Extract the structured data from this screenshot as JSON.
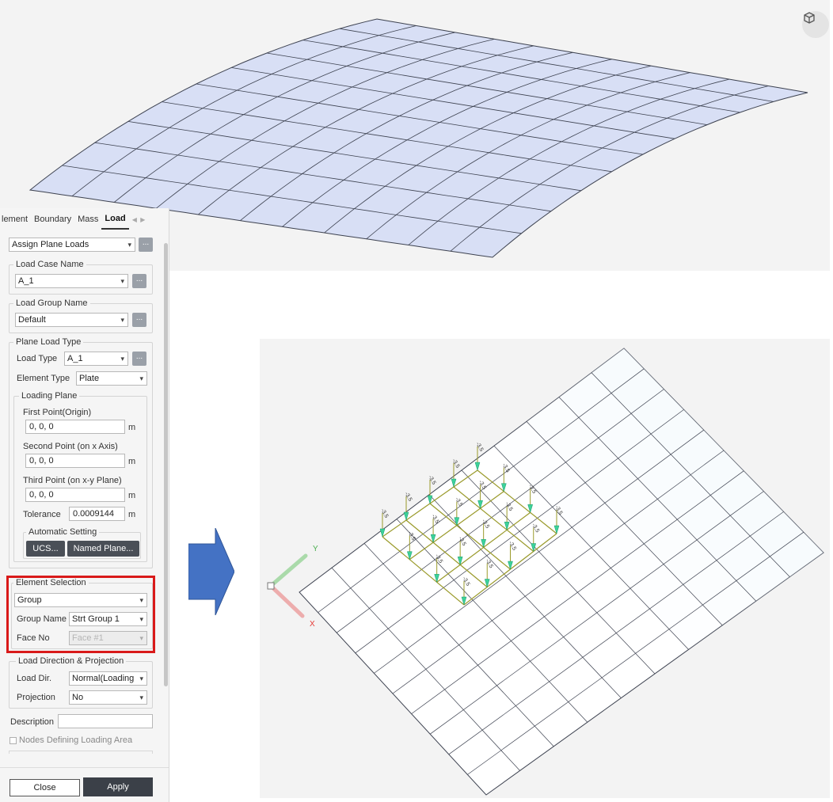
{
  "tabs": {
    "items": [
      "lement",
      "Boundary",
      "Mass",
      "Load"
    ],
    "active": "Load"
  },
  "panel": {
    "command": {
      "value": "Assign Plane Loads",
      "more": "..."
    },
    "load_case": {
      "legend": "Load Case Name",
      "value": "A_1",
      "more": "..."
    },
    "load_group": {
      "legend": "Load Group Name",
      "value": "Default",
      "more": "..."
    },
    "plane_load_type": {
      "legend": "Plane Load Type",
      "load_type_label": "Load Type",
      "load_type_value": "A_1",
      "load_type_more": "...",
      "element_type_label": "Element Type",
      "element_type_value": "Plate"
    },
    "loading_plane": {
      "legend": "Loading Plane",
      "first_point_label": "First Point(Origin)",
      "first_point_value": "0, 0, 0",
      "second_point_label": "Second Point (on x Axis)",
      "second_point_value": "0, 0, 0",
      "third_point_label": "Third Point (on x-y Plane)",
      "third_point_value": "0, 0, 0",
      "unit": "m",
      "tolerance_label": "Tolerance",
      "tolerance_value": "0.0009144",
      "auto_legend": "Automatic Setting",
      "ucs_button": "UCS...",
      "named_plane_button": "Named Plane..."
    },
    "element_selection": {
      "legend": "Element Selection",
      "mode_value": "Group",
      "group_name_label": "Group Name",
      "group_name_value": "Strt Group 1",
      "face_no_label": "Face No",
      "face_no_value": "Face #1"
    },
    "load_direction": {
      "legend": "Load Direction & Projection",
      "load_dir_label": "Load Dir.",
      "load_dir_value": "Normal(Loading",
      "projection_label": "Projection",
      "projection_value": "No"
    },
    "description_label": "Description",
    "description_value": "",
    "nodes_defining_label": "Nodes Defining Loading Area",
    "close_button": "Close",
    "apply_button": "Apply"
  },
  "viewport_bottom": {
    "axis_x_label": "X",
    "axis_y_label": "Y",
    "load_value_label": "-3.5"
  },
  "colors": {
    "mesh_fill_top": "#d8dff5",
    "mesh_fill_bottom": "#f1f8fc",
    "mesh_line": "#3d4250",
    "load_frame": "#9a9a2a",
    "load_arrow": "#3dd29a",
    "highlight": "#d91a1a",
    "arrow_fill": "#4472c4"
  },
  "icons": {
    "view_cube": "cube-icon",
    "tab_scroll": "chevron-left-right-icon",
    "transition": "right-arrow-icon"
  }
}
